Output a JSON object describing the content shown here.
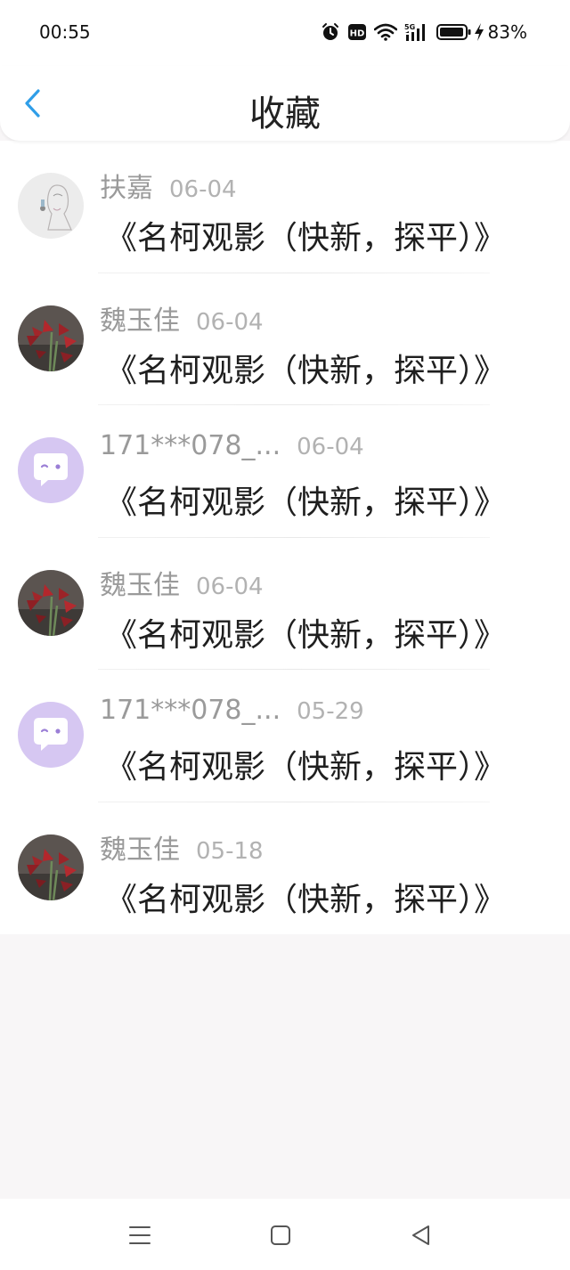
{
  "status_bar": {
    "time": "00:55",
    "battery_percent": "83%",
    "icons": [
      "alarm-icon",
      "hd-icon",
      "wifi-icon",
      "5g-signal-icon",
      "battery-icon",
      "charging-icon"
    ]
  },
  "header": {
    "title": "收藏",
    "back_icon": "chevron-left-icon",
    "accent_color": "#2f9ee8"
  },
  "favorites": [
    {
      "user": "扶嘉",
      "date": "06-04",
      "title": "《名柯观影（快新，探平）》",
      "avatar": "sketch"
    },
    {
      "user": "魏玉佳",
      "date": "06-04",
      "title": "《名柯观影（快新，探平）》",
      "avatar": "flowers"
    },
    {
      "user": "171***078_...",
      "date": "06-04",
      "title": "《名柯观影（快新，探平）》",
      "avatar": "default-chat"
    },
    {
      "user": "魏玉佳",
      "date": "06-04",
      "title": "《名柯观影（快新，探平）》",
      "avatar": "flowers"
    },
    {
      "user": "171***078_...",
      "date": "05-29",
      "title": "《名柯观影（快新，探平）》",
      "avatar": "default-chat"
    },
    {
      "user": "魏玉佳",
      "date": "05-18",
      "title": "《名柯观影（快新，探平）》",
      "avatar": "flowers"
    }
  ],
  "nav_bar": {
    "icons": [
      "menu-icon",
      "home-square-icon",
      "back-triangle-icon"
    ]
  }
}
